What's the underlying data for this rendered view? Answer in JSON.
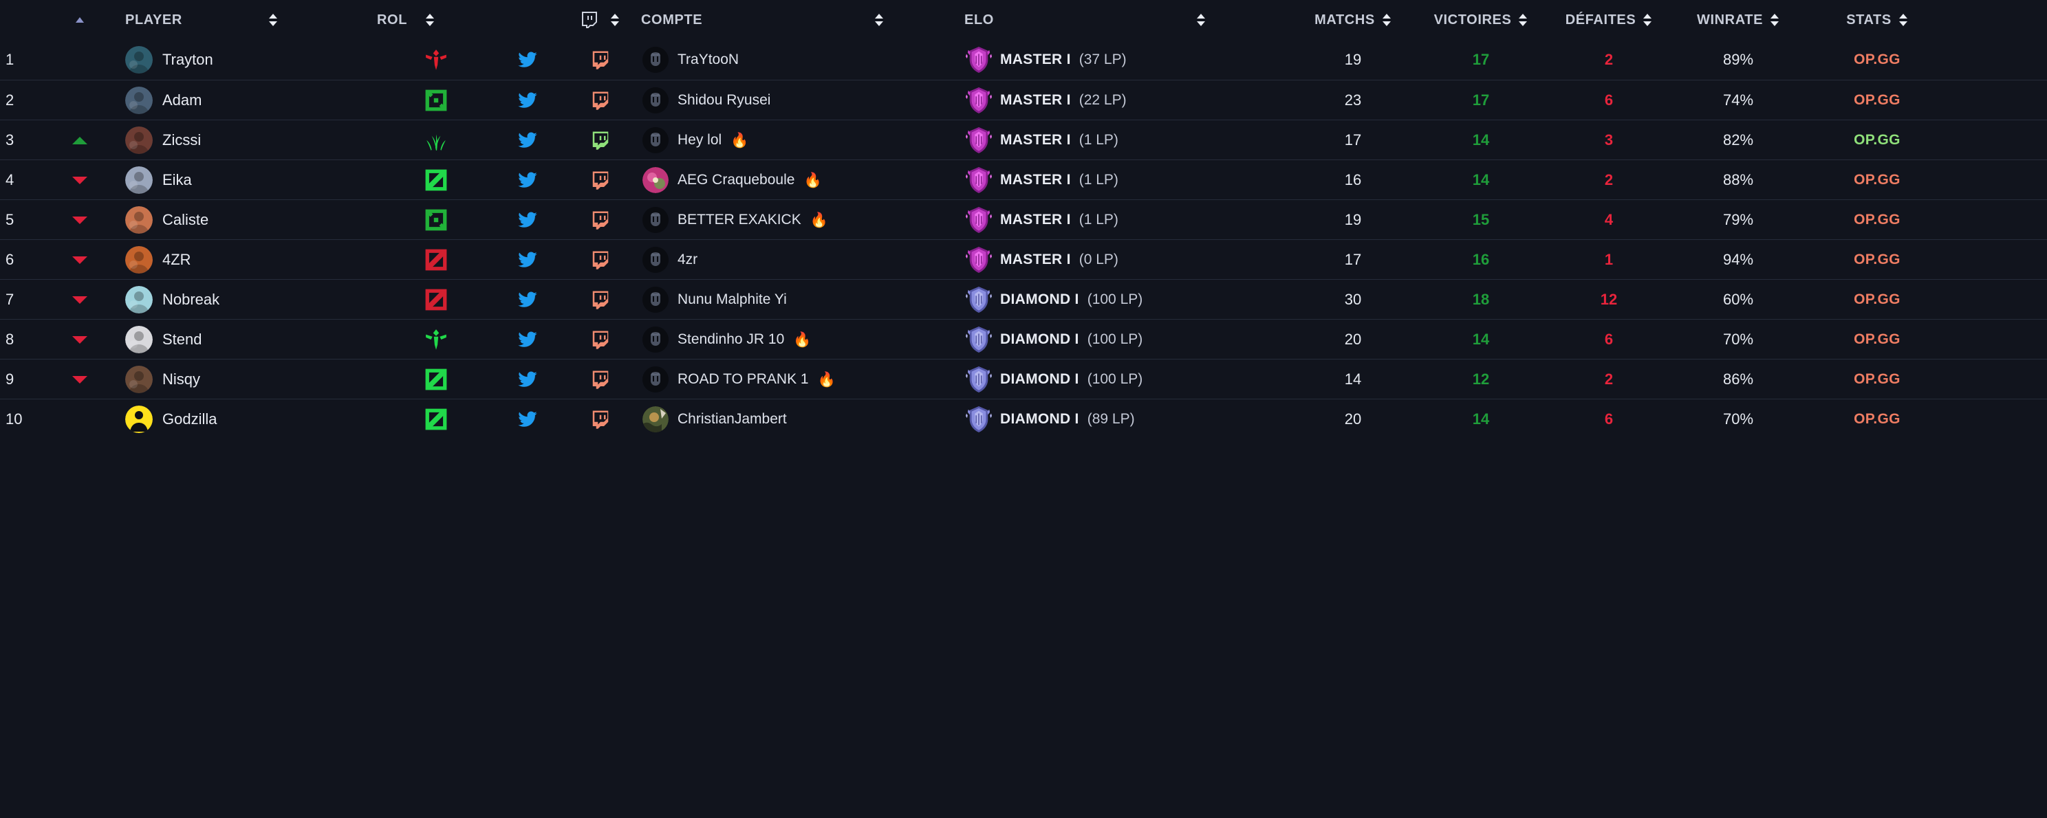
{
  "table": {
    "headers": [
      {
        "label": "",
        "sort": "active-asc",
        "icon": ""
      },
      {
        "label": "PLAYER",
        "sort": "both",
        "icon": ""
      },
      {
        "label": "ROL",
        "sort": "both",
        "icon": ""
      },
      {
        "label": "",
        "sort": "both",
        "icon": "twitch-icon"
      },
      {
        "label": "COMPTE",
        "sort": "both",
        "icon": ""
      },
      {
        "label": "ELO",
        "sort": "both",
        "icon": ""
      },
      {
        "label": "MATCHS",
        "sort": "both",
        "icon": ""
      },
      {
        "label": "VICTOIRES",
        "sort": "both",
        "icon": ""
      },
      {
        "label": "DÉFAITES",
        "sort": "both",
        "icon": ""
      },
      {
        "label": "WINRATE",
        "sort": "both",
        "icon": ""
      },
      {
        "label": "STATS",
        "sort": "both",
        "icon": ""
      }
    ],
    "rows": [
      {
        "rank": "1",
        "delta": "none",
        "player": "Trayton",
        "avatar_color": "#2e5d6e",
        "role": "support",
        "role_color": "#e01f2d",
        "twitter": "twitter-icon",
        "twitch_color": "#ef8b70",
        "account": "TraYtooN",
        "hot": "",
        "acct_art": "default",
        "tier": "MASTER I",
        "lp": "(37 LP)",
        "tier_kind": "master",
        "matchs": "19",
        "victoires": "17",
        "defaites": "2",
        "winrate": "89%",
        "stats": "OP.GG",
        "stats_color": "red"
      },
      {
        "rank": "2",
        "delta": "none",
        "player": "Adam",
        "avatar_color": "#4a6077",
        "role": "bot",
        "role_color": "#21b239",
        "twitter": "twitter-icon",
        "twitch_color": "#ef8b70",
        "account": "Shidou Ryusei",
        "hot": "",
        "acct_art": "default",
        "tier": "MASTER I",
        "lp": "(22 LP)",
        "tier_kind": "master",
        "matchs": "23",
        "victoires": "17",
        "defaites": "6",
        "winrate": "74%",
        "stats": "OP.GG",
        "stats_color": "red"
      },
      {
        "rank": "3",
        "delta": "up",
        "player": "Zicssi",
        "avatar_color": "#6d3c33",
        "role": "jungle",
        "role_color": "#21d94a",
        "twitter": "twitter-icon",
        "twitch_color": "#8fe07a",
        "account": "Hey lol",
        "hot": "🔥",
        "acct_art": "default",
        "tier": "MASTER I",
        "lp": "(1 LP)",
        "tier_kind": "master",
        "matchs": "17",
        "victoires": "14",
        "defaites": "3",
        "winrate": "82%",
        "stats": "OP.GG",
        "stats_color": "green"
      },
      {
        "rank": "4",
        "delta": "down",
        "player": "Eika",
        "avatar_color": "#9aa6bc",
        "role": "mid",
        "role_color": "#21d94a",
        "twitter": "twitter-icon",
        "twitch_color": "#ef8b70",
        "account": "AEG Craqueboule",
        "hot": "🔥",
        "acct_art": "pink",
        "tier": "MASTER I",
        "lp": "(1 LP)",
        "tier_kind": "master",
        "matchs": "16",
        "victoires": "14",
        "defaites": "2",
        "winrate": "88%",
        "stats": "OP.GG",
        "stats_color": "red"
      },
      {
        "rank": "5",
        "delta": "down",
        "player": "Caliste",
        "avatar_color": "#c8734d",
        "role": "bot",
        "role_color": "#21b239",
        "twitter": "twitter-icon",
        "twitch_color": "#ef8b70",
        "account": "BETTER EXAKICK",
        "hot": "🔥",
        "acct_art": "default",
        "tier": "MASTER I",
        "lp": "(1 LP)",
        "tier_kind": "master",
        "matchs": "19",
        "victoires": "15",
        "defaites": "4",
        "winrate": "79%",
        "stats": "OP.GG",
        "stats_color": "red"
      },
      {
        "rank": "6",
        "delta": "down",
        "player": "4ZR",
        "avatar_color": "#c4622c",
        "role": "mid",
        "role_color": "#d32030",
        "twitter": "twitter-icon",
        "twitch_color": "#ef8b70",
        "account": "4zr",
        "hot": "",
        "acct_art": "default",
        "tier": "MASTER I",
        "lp": "(0 LP)",
        "tier_kind": "master",
        "matchs": "17",
        "victoires": "16",
        "defaites": "1",
        "winrate": "94%",
        "stats": "OP.GG",
        "stats_color": "red"
      },
      {
        "rank": "7",
        "delta": "down",
        "player": "Nobreak",
        "avatar_color": "#9fd3dd",
        "role": "mid",
        "role_color": "#d32030",
        "twitter": "twitter-icon",
        "twitch_color": "#ef8b70",
        "account": "Nunu Malphite Yi",
        "hot": "",
        "acct_art": "default",
        "tier": "DIAMOND I",
        "lp": "(100 LP)",
        "tier_kind": "diamond",
        "matchs": "30",
        "victoires": "18",
        "defaites": "12",
        "winrate": "60%",
        "stats": "OP.GG",
        "stats_color": "red"
      },
      {
        "rank": "8",
        "delta": "down",
        "player": "Stend",
        "avatar_color": "#d9d9dd",
        "role": "support",
        "role_color": "#21d94a",
        "twitter": "twitter-icon",
        "twitch_color": "#ef8b70",
        "account": "Stendinho JR 10",
        "hot": "🔥",
        "acct_art": "default",
        "tier": "DIAMOND I",
        "lp": "(100 LP)",
        "tier_kind": "diamond",
        "matchs": "20",
        "victoires": "14",
        "defaites": "6",
        "winrate": "70%",
        "stats": "OP.GG",
        "stats_color": "red"
      },
      {
        "rank": "9",
        "delta": "down",
        "player": "Nisqy",
        "avatar_color": "#6b4b38",
        "role": "mid",
        "role_color": "#21d94a",
        "twitter": "twitter-icon",
        "twitch_color": "#ef8b70",
        "account": "ROAD TO PRANK 1",
        "hot": "🔥",
        "acct_art": "default",
        "tier": "DIAMOND I",
        "lp": "(100 LP)",
        "tier_kind": "diamond",
        "matchs": "14",
        "victoires": "12",
        "defaites": "2",
        "winrate": "86%",
        "stats": "OP.GG",
        "stats_color": "red"
      },
      {
        "rank": "10",
        "delta": "none",
        "player": "Godzilla",
        "avatar_color": "#ffe01b",
        "role": "mid",
        "role_color": "#21d94a",
        "twitter": "twitter-icon",
        "twitch_color": "#ef8b70",
        "account": "ChristianJambert",
        "hot": "",
        "acct_art": "photo",
        "tier": "DIAMOND I",
        "lp": "(89 LP)",
        "tier_kind": "diamond",
        "matchs": "20",
        "victoires": "14",
        "defaites": "6",
        "winrate": "70%",
        "stats": "OP.GG",
        "stats_color": "red"
      }
    ]
  },
  "colors": {
    "background": "#11141d",
    "divider": "#262c3a",
    "win_green": "#1f9d3a",
    "loss_red": "#e8243c",
    "opgg_red": "#ef7d63",
    "opgg_green": "#8fe07a",
    "twitter_blue": "#1d9bf0",
    "master_crest": "#d45fd6",
    "diamond_crest": "#8b8fe0"
  }
}
